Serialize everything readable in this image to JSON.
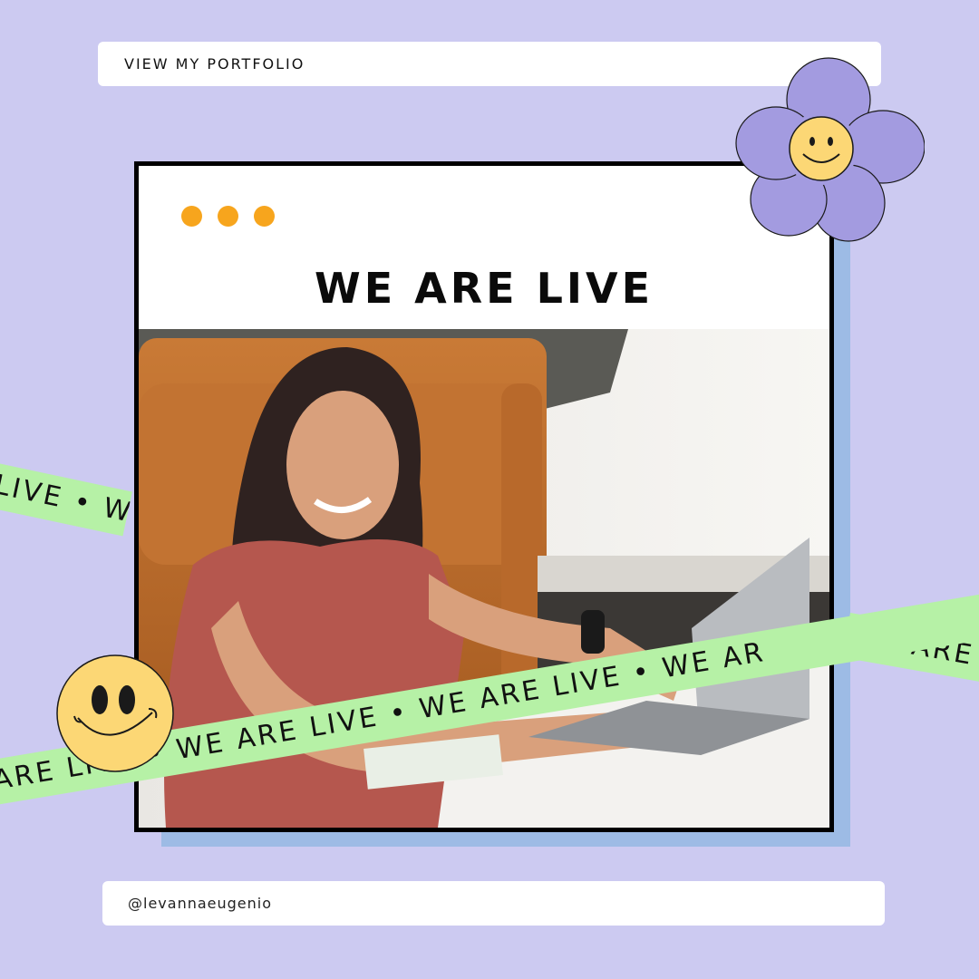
{
  "header": {
    "portfolio_label": "VIEW MY PORTFOLIO"
  },
  "card": {
    "headline": "WE ARE LIVE"
  },
  "ribbons": {
    "main": "ARE LIVE • WE ARE LIVE • WE ARE LIVE • WE AR",
    "left": "LIVE • W",
    "right": "WE ARE"
  },
  "footer": {
    "handle": "@levannaeugenio"
  },
  "colors": {
    "background": "#cccaf1",
    "ribbon": "#b6f1a6",
    "dots": "#f7a51d",
    "flower": "#a39be0",
    "smiley": "#fcd775",
    "shadow": "#9dbbe5"
  },
  "icons": [
    "flower-smiley-icon",
    "smiley-face-icon"
  ]
}
